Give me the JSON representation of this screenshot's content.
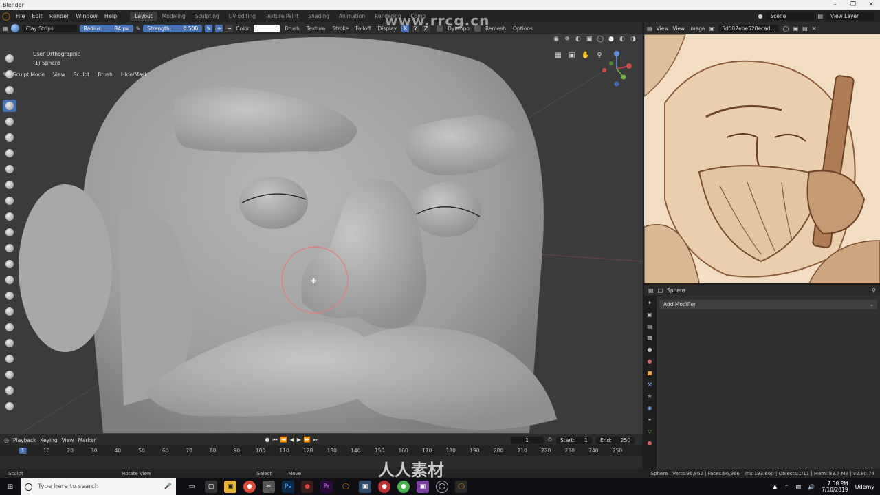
{
  "window": {
    "title": "Blender"
  },
  "menu": {
    "items": [
      "File",
      "Edit",
      "Render",
      "Window",
      "Help"
    ],
    "workspaces": [
      "Layout",
      "Modeling",
      "Sculpting",
      "UV Editing",
      "Texture Paint",
      "Shading",
      "Animation",
      "Rendering",
      "Comp"
    ],
    "active_workspace": "Layout",
    "scene": "Scene",
    "view_layer": "View Layer"
  },
  "tool_header": {
    "brush_name": "Clay Strips",
    "radius_label": "Radius:",
    "radius_value": "84 px",
    "strength_label": "Strength:",
    "strength_value": "0.500",
    "color_label": "Color:",
    "menus": [
      "Brush",
      "Texture",
      "Stroke",
      "Falloff",
      "Display"
    ],
    "symmetry": [
      "X",
      "Y",
      "Z"
    ],
    "dyntopo": "Dyntopo",
    "remesh": "Remesh",
    "options": "Options",
    "color_value": "#ffffff"
  },
  "mode_header": {
    "mode": "Sculpt Mode",
    "menus": [
      "View",
      "Sculpt",
      "Brush",
      "Hide/Mask"
    ]
  },
  "viewport": {
    "view_name": "User Orthographic",
    "object_name": "(1) Sphere"
  },
  "image_editor": {
    "menus": [
      "View",
      "View",
      "Image"
    ],
    "image_name": "5d507ebe520ecad..."
  },
  "properties": {
    "object": "Sphere",
    "add_modifier": "Add Modifier"
  },
  "timeline": {
    "menus": [
      "Playback",
      "Keying",
      "View",
      "Marker"
    ],
    "current_frame": "1",
    "start_label": "Start:",
    "start": "1",
    "end_label": "End:",
    "end": "250",
    "ticks": [
      "1",
      "10",
      "20",
      "30",
      "40",
      "50",
      "60",
      "70",
      "80",
      "90",
      "100",
      "110",
      "120",
      "130",
      "140",
      "150",
      "160",
      "170",
      "180",
      "190",
      "200",
      "210",
      "220",
      "230",
      "240",
      "250"
    ]
  },
  "statusbar": {
    "items": [
      "Sculpt",
      "Rotate View",
      "Select",
      "Move"
    ],
    "stats": "Sphere | Verts:96,862 | Faces:96,966 | Tris:193,660 | Objects:1/11 | Mem: 93.7 MB | v2.80.74"
  },
  "taskbar": {
    "search_placeholder": "Type here to search",
    "time": "7:58 PM",
    "date": "7/10/2019",
    "user": "Udemy"
  },
  "watermarks": {
    "top": "www.rrcg.cn",
    "bottom": "人人素材"
  }
}
